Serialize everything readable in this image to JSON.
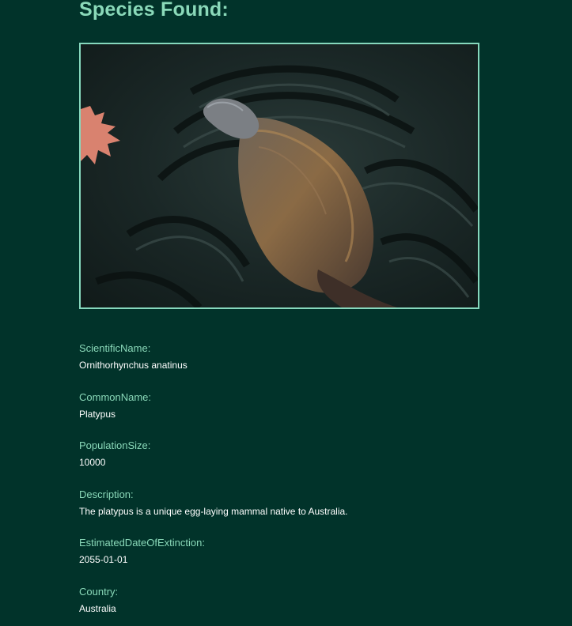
{
  "page": {
    "title": "Species Found:"
  },
  "photo": {
    "subject": "platypus swimming in dark water with floating maple leaf",
    "colors": {
      "frame": "#86d8bd",
      "water": "#1b2a29",
      "leaf": "#d9826f"
    }
  },
  "species": {
    "fields": [
      {
        "label": "ScientificName:",
        "value": "Ornithorhynchus anatinus"
      },
      {
        "label": "CommonName:",
        "value": "Platypus"
      },
      {
        "label": "PopulationSize:",
        "value": "10000"
      },
      {
        "label": "Description:",
        "value": "The platypus is a unique egg-laying mammal native to Australia."
      },
      {
        "label": "EstimatedDateOfExtinction:",
        "value": "2055-01-01"
      },
      {
        "label": "Country:",
        "value": "Australia"
      }
    ]
  },
  "theme": {
    "background": "#01332a",
    "accent": "#8ad9b9",
    "text": "#ffffff"
  }
}
